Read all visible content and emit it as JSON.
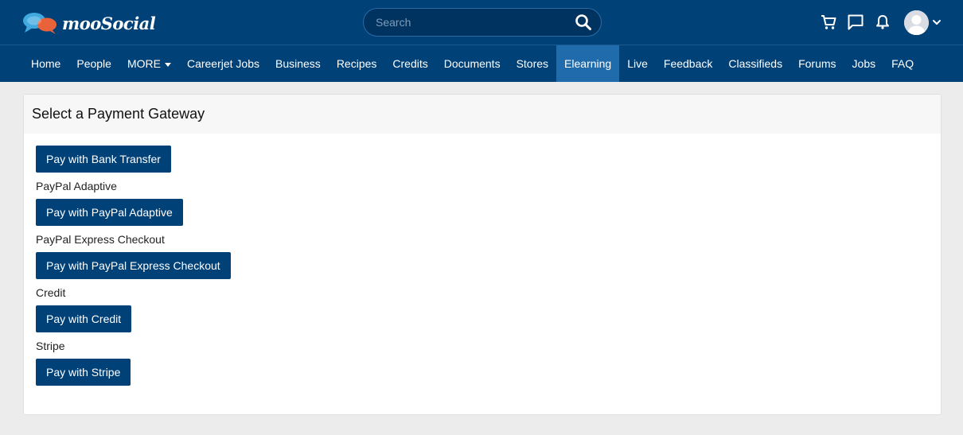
{
  "header": {
    "logo_text": "mooSocial",
    "search_placeholder": "Search"
  },
  "nav": {
    "items": [
      {
        "label": "Home"
      },
      {
        "label": "People"
      },
      {
        "label": "MORE"
      },
      {
        "label": "Careerjet Jobs"
      },
      {
        "label": "Business"
      },
      {
        "label": "Recipes"
      },
      {
        "label": "Credits"
      },
      {
        "label": "Documents"
      },
      {
        "label": "Stores"
      },
      {
        "label": "Elearning"
      },
      {
        "label": "Live"
      },
      {
        "label": "Feedback"
      },
      {
        "label": "Classifieds"
      },
      {
        "label": "Forums"
      },
      {
        "label": "Jobs"
      },
      {
        "label": "FAQ"
      }
    ],
    "active": "Elearning"
  },
  "panel": {
    "title": "Select a Payment Gateway",
    "gateways": [
      {
        "label": "",
        "button": "Pay with Bank Transfer"
      },
      {
        "label": "PayPal Adaptive",
        "button": "Pay with PayPal Adaptive"
      },
      {
        "label": "PayPal Express Checkout",
        "button": "Pay with PayPal Express Checkout"
      },
      {
        "label": "Credit",
        "button": "Pay with Credit"
      },
      {
        "label": "Stripe",
        "button": "Pay with Stripe"
      }
    ]
  },
  "colors": {
    "brand": "#004178",
    "nav_active": "#1f6bab",
    "page_bg": "#ececec"
  },
  "icons": [
    "search-icon",
    "cart-icon",
    "message-icon",
    "bell-icon",
    "avatar",
    "chevron-down-icon"
  ]
}
